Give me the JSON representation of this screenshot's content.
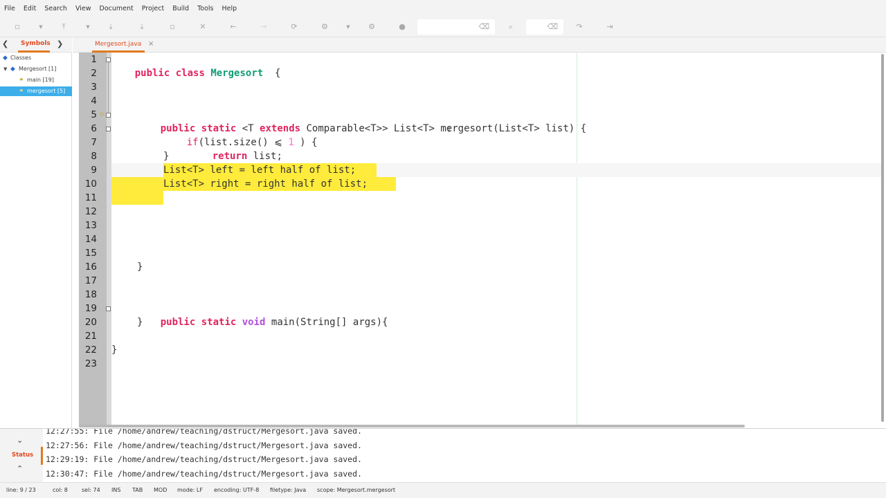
{
  "menubar": {
    "items": [
      "File",
      "Edit",
      "Search",
      "View",
      "Document",
      "Project",
      "Build",
      "Tools",
      "Help"
    ]
  },
  "toolbar": {
    "icons": [
      "new-file-icon",
      "dropdown-icon",
      "open-file-icon",
      "dropdown-icon",
      "save-icon",
      "save-all-icon",
      "revert-icon",
      "close-icon",
      "back-icon",
      "forward-icon",
      "compile-icon",
      "build-icon",
      "dropdown-icon",
      "run-icon",
      "color-chooser-icon",
      "search-icon",
      "goto-line-icon",
      "quit-icon"
    ],
    "search_value": "",
    "goto_value": ""
  },
  "sidebar": {
    "tab_label": "Symbols",
    "tree": [
      {
        "label": "Classes",
        "level": 0
      },
      {
        "label": "Mergesort [1]",
        "level": 1
      },
      {
        "label": "main [19]",
        "level": 2
      },
      {
        "label": "mergesort [5]",
        "level": 2,
        "selected": true
      }
    ]
  },
  "editor": {
    "tab_label": "Mergesort.java",
    "line_numbers": [
      "1",
      "2",
      "3",
      "4",
      "5",
      "6",
      "7",
      "8",
      "9",
      "10",
      "11",
      "12",
      "13",
      "14",
      "15",
      "16",
      "17",
      "18",
      "19",
      "20",
      "21",
      "22",
      "23"
    ],
    "lines": {
      "l1": {
        "kw1": "public",
        "kw2": "class",
        "cls": "Mergesort",
        "rest": "  {"
      },
      "l5": {
        "kw1": "public",
        "kw2": "static",
        "p1": "<T",
        "kw3": "extends",
        "rest": "Comparable<T>> List<T> mergesort(List<T> list) {"
      },
      "l6": {
        "kw1": "if",
        "p1": "(list.size() ⩽ ",
        "num": "1",
        "rest": " ) {"
      },
      "l7": {
        "kw1": "return",
        "rest": " list;"
      },
      "l8": {
        "text": "}"
      },
      "l9": {
        "text": "List<T> left = left half of list;"
      },
      "l10": {
        "text": "List<T> right = right half of list;"
      },
      "l16": {
        "text": "}"
      },
      "l19": {
        "kw1": "public",
        "kw2": "static",
        "typ": "void",
        "rest": " main(String[] args){"
      },
      "l20": {
        "text": "}"
      },
      "l22": {
        "text": "}"
      }
    }
  },
  "messages": {
    "tab_label": "Status",
    "lines": [
      "12:27:55: File /home/andrew/teaching/dstruct/Mergesort.java saved.",
      "12:27:56: File /home/andrew/teaching/dstruct/Mergesort.java saved.",
      "12:29:19: File /home/andrew/teaching/dstruct/Mergesort.java saved.",
      "12:30:47: File /home/andrew/teaching/dstruct/Mergesort.java saved."
    ],
    "partial_line": "12:27:55: File /home/andrew/teaching/dstruct/Mergesort.java saved."
  },
  "statusbar": {
    "line": "line: 9 / 23",
    "col": "col: 8",
    "sel": "sel: 74",
    "ins": "INS",
    "tab": "TAB",
    "mod": "MOD",
    "mode": "mode: LF",
    "encoding": "encoding: UTF-8",
    "filetype": "filetype: Java",
    "scope": "scope: Mergesort.mergesort"
  },
  "colors": {
    "keyword": "#e0245e",
    "class_name": "#0f9d74",
    "type": "#b04fd8",
    "number": "#ff6ec7",
    "selection": "#ffeb3b",
    "accent": "#e07a1f",
    "tree_selected": "#3daee9"
  }
}
